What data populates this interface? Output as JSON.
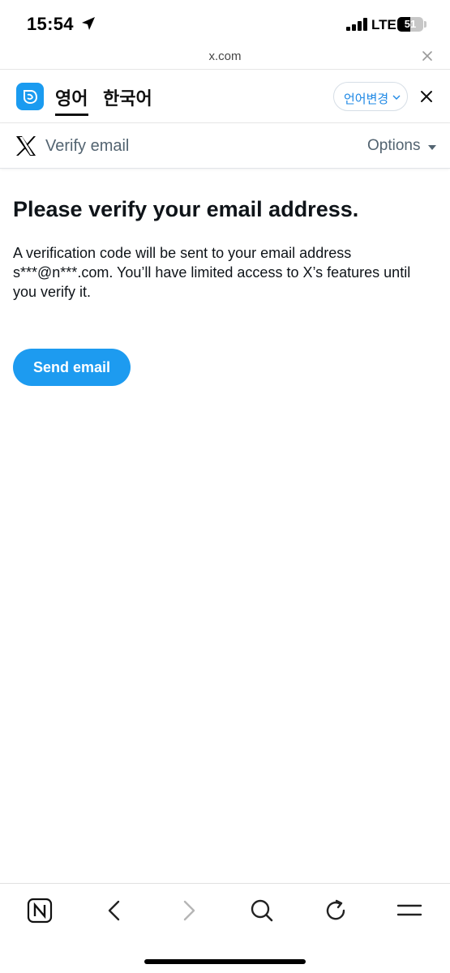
{
  "status_bar": {
    "time": "15:54",
    "network": "LTE",
    "battery_level": "51",
    "battery_percent": 51
  },
  "browser": {
    "url": "x.com",
    "icons": {
      "close": "close-icon"
    }
  },
  "translate_bar": {
    "source_language": "영어",
    "target_language": "한국어",
    "change_language_label": "언어변경",
    "icons": {
      "app": "papago-icon",
      "chevron": "chevron-down-icon",
      "close": "close-icon"
    },
    "accent_color": "#1e88e5"
  },
  "header": {
    "title": "Verify email",
    "options_label": "Options",
    "icons": {
      "logo": "x-logo-icon",
      "dropdown": "caret-down-icon"
    }
  },
  "main": {
    "heading": "Please verify your email address.",
    "description": "A verification code will be sent to your email address s***@n***.com. You’ll have limited access to X’s features until you verify it.",
    "send_button_label": "Send email",
    "button_color": "#1d9bf0"
  },
  "toolbar": {
    "icons": [
      "naver-home-icon",
      "back-arrow-icon",
      "forward-arrow-icon",
      "search-icon",
      "refresh-icon",
      "menu-icon"
    ]
  }
}
